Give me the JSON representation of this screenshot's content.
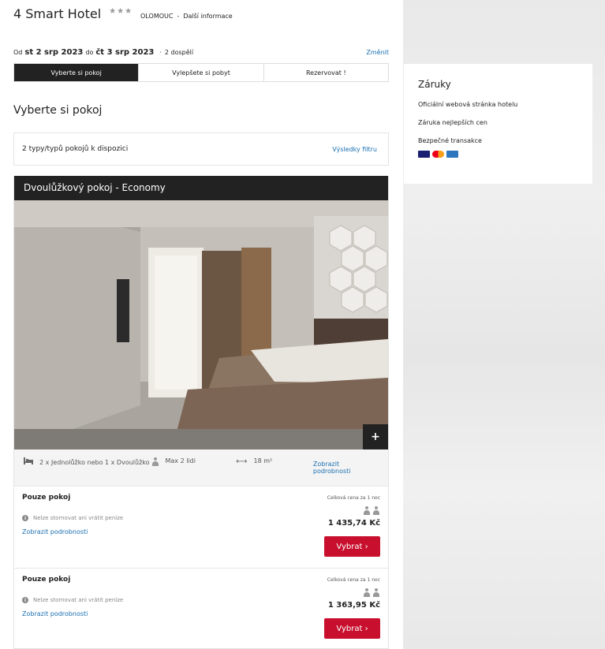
{
  "header": {
    "hotel_name": "4 Smart Hotel",
    "stars": "★★★",
    "city": "OLOMOUC",
    "separator": "-",
    "more_info": "Další informace"
  },
  "dates": {
    "from_label": "Od",
    "from_date": "st 2 srp 2023",
    "to_label": "do",
    "to_date": "čt 3 srp 2023",
    "separator": "·",
    "guests": "2 dospělí",
    "change_link": "Změnit"
  },
  "steps": [
    {
      "label": "Vyberte si pokoj",
      "active": true
    },
    {
      "label": "Vylepšete si pobyt",
      "active": false
    },
    {
      "label": "Rezervovat !",
      "active": false
    }
  ],
  "section_title": "Vyberte si pokoj",
  "filter": {
    "count_text": "2 typy/typů pokojů k dispozici",
    "results_link": "Výsledky filtru"
  },
  "room": {
    "title": "Dvoulůžkový pokoj - Economy",
    "zoom_symbol": "+",
    "features": {
      "bed_icon": "bed-icon",
      "bed": "2 x Jednolůžko nebo 1 x Dvoulůžko",
      "max_icon": "person-icon",
      "max": "Max 2 lidi",
      "size_icon": "arrows-horizontal-icon",
      "size": "18 m²",
      "details_link": "Zobrazit podrobnosti"
    },
    "rates": [
      {
        "title": "Pouze pokoj",
        "note": "Nelze stornovat ani vrátit peníze",
        "details_link": "Zobrazit podrobnosti",
        "price_label": "Celková cena za 1 noc",
        "price": "1 435,74 Kč",
        "button": "Vybrat ›"
      },
      {
        "title": "Pouze pokoj",
        "note": "Nelze stornovat ani vrátit peníze",
        "details_link": "Zobrazit podrobnosti",
        "price_label": "Celková cena za 1 noc",
        "price": "1 363,95 Kč",
        "button": "Vybrat ›"
      }
    ]
  },
  "guarantees": {
    "title": "Záruky",
    "items": [
      "Oficiální webová stránka hotelu",
      "Záruka nejlepších cen",
      "Bezpečné transakce"
    ],
    "cards": [
      "visa-icon",
      "mastercard-icon",
      "amex-icon"
    ]
  },
  "colors": {
    "accent_red": "#c8102e",
    "link_blue": "#1a6fb0",
    "dark": "#222222"
  }
}
